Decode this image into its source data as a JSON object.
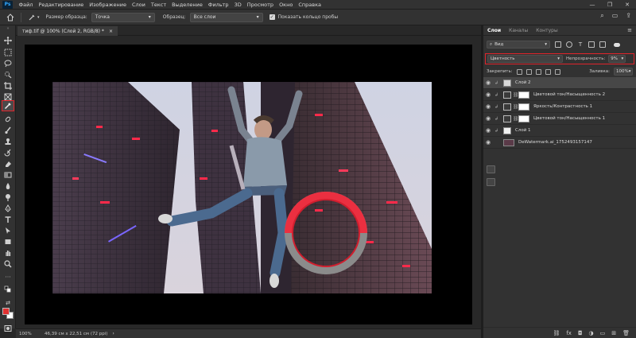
{
  "menu": [
    "Файл",
    "Редактирование",
    "Изображение",
    "Слои",
    "Текст",
    "Выделение",
    "Фильтр",
    "3D",
    "Просмотр",
    "Окно",
    "Справка"
  ],
  "app_logo": "Ps",
  "window_controls": [
    "—",
    "❐",
    "✕"
  ],
  "options_bar": {
    "sample_size_label": "Размер образца:",
    "sample_size_value": "Точка",
    "sample_label": "Образец:",
    "sample_value": "Все слои",
    "show_ring_label": "Показать кольцо пробы"
  },
  "document": {
    "tab_title": "тиф.tif @ 100% (Слой 2, RGB/8) *",
    "tab_close": "×",
    "zoom": "100%",
    "doc_info": "46,39 см x 22,51 см (72 ppi)"
  },
  "layers_panel": {
    "tabs": [
      "Слои",
      "Каналы",
      "Контуры"
    ],
    "menu_icon": "≡",
    "filter_kind": "Вид",
    "blend_mode": "Цветность",
    "opacity_label": "Непрозрачность:",
    "opacity_value": "9%",
    "lock_label": "Закрепить:",
    "fill_label": "Заливка:",
    "fill_value": "100%",
    "layers": [
      {
        "name": "Слой 2",
        "selected": true,
        "type": "pixel"
      },
      {
        "name": "Цветовой тон/Насыщенность 2",
        "selected": false,
        "type": "adjustment"
      },
      {
        "name": "Яркость/Контрастность 1",
        "selected": false,
        "type": "adjustment"
      },
      {
        "name": "Цветовой тон/Насыщенность 1",
        "selected": false,
        "type": "adjustment"
      },
      {
        "name": "Слой 1",
        "selected": false,
        "type": "pixel"
      },
      {
        "name": "DeWatermark.ai_1752493157147",
        "selected": false,
        "type": "image"
      }
    ],
    "footer_icons": [
      "link-icon",
      "fx-icon",
      "mask-icon",
      "adjustment-icon",
      "folder-icon",
      "new-layer-icon",
      "trash-icon"
    ],
    "footer_glyphs": [
      "⛓",
      "fx",
      "◘",
      "◑",
      "▭",
      "⊞",
      "🗑"
    ]
  },
  "colors": {
    "foreground": "#e13131",
    "background": "#ffffff",
    "highlight": "#e0242b"
  }
}
